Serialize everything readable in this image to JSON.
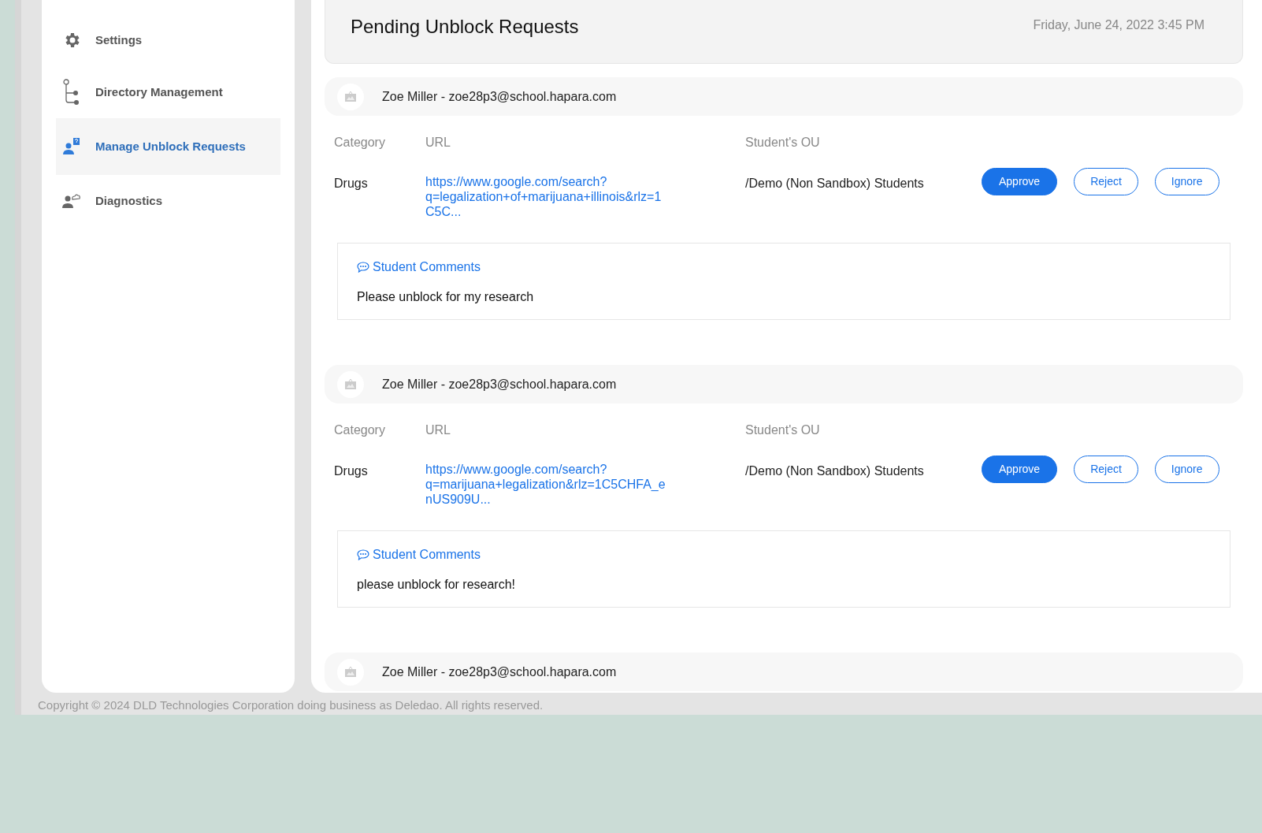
{
  "sidebar": {
    "items": [
      {
        "label": "Settings",
        "selected": false
      },
      {
        "label": "Directory Management",
        "selected": false
      },
      {
        "label": "Manage Unblock Requests",
        "selected": true
      },
      {
        "label": "Diagnostics",
        "selected": false
      }
    ]
  },
  "header": {
    "title": "Pending Unblock Requests",
    "date": "Friday, June 24, 2022 3:45 PM"
  },
  "requests": [
    {
      "student": "Zoe Miller - zoe28p3@school.hapara.com",
      "columns": [
        "Category",
        "URL",
        "Student's OU"
      ],
      "category": "Drugs",
      "url": "https://www.google.com/search?q=legalization+of+marijuana+illinois&rlz=1C5C...",
      "ou": "/Demo (Non Sandbox) Students",
      "buttons": [
        {
          "label": "Approve",
          "kind": "primary"
        },
        {
          "label": "Reject",
          "kind": "outline"
        },
        {
          "label": "Ignore",
          "kind": "outline"
        }
      ],
      "comments_title": "Student Comments",
      "comment": "Please unblock for my research"
    },
    {
      "student": "Zoe Miller - zoe28p3@school.hapara.com",
      "columns": [
        "Category",
        "URL",
        "Student's OU"
      ],
      "category": "Drugs",
      "url": "https://www.google.com/search?q=marijuana+legalization&rlz=1C5CHFA_enUS909U...",
      "ou": "/Demo (Non Sandbox) Students",
      "buttons": [
        {
          "label": "Approve",
          "kind": "primary"
        },
        {
          "label": "Reject",
          "kind": "outline"
        },
        {
          "label": "Ignore",
          "kind": "outline"
        }
      ],
      "comments_title": "Student Comments",
      "comment": "please unblock for research!"
    },
    {
      "student": "Zoe Miller - zoe28p3@school.hapara.com"
    }
  ],
  "footer": "Copyright © 2024 DLD Technologies Corporation doing business as Deledao. All rights reserved."
}
